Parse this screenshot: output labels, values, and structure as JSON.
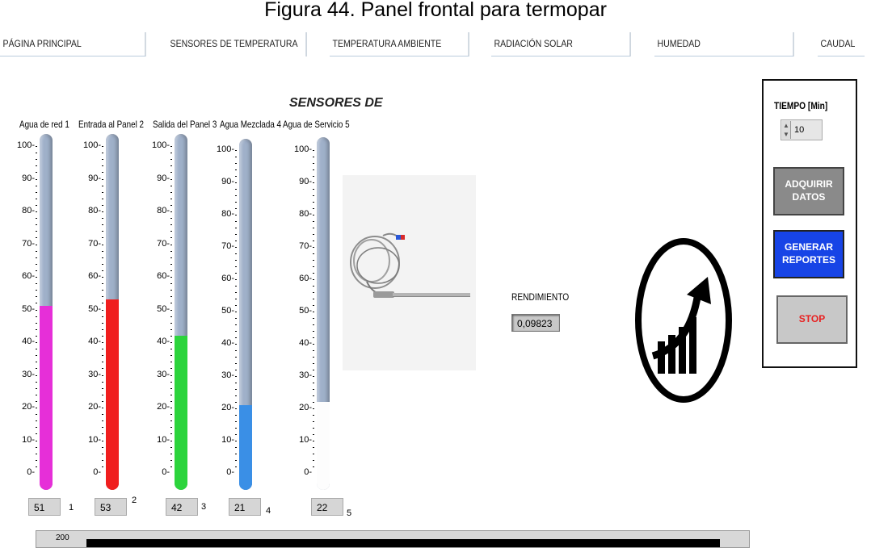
{
  "caption": "Figura 44. Panel frontal para termopar",
  "tabs": [
    "PÁGINA PRINCIPAL",
    "SENSORES DE TEMPERATURA",
    "TEMPERATURA AMBIENTE",
    "RADIACIÓN SOLAR",
    "HUMEDAD",
    "CAUDAL"
  ],
  "section_title": "SENSORES DE",
  "thermometers": [
    {
      "label": "Agua de red 1",
      "value": "51",
      "index": "1",
      "fill_pct": 51,
      "color": "#e62fd8"
    },
    {
      "label": "Entrada al Panel 2",
      "value": "53",
      "index": "2",
      "fill_pct": 53,
      "color": "#f01e1e"
    },
    {
      "label": "Salida del Panel 3",
      "value": "42",
      "index": "3",
      "fill_pct": 42,
      "color": "#2cd43c"
    },
    {
      "label": "Agua Mezclada 4",
      "value": "21",
      "index": "4",
      "fill_pct": 21,
      "color": "#3a8fe6"
    },
    {
      "label": "Agua de Servicio 5",
      "value": "22",
      "index": "5",
      "fill_pct": 22,
      "color": "#ffffff"
    }
  ],
  "scale_ticks": [
    "100",
    "90",
    "80",
    "70",
    "60",
    "50",
    "40",
    "30",
    "20",
    "10",
    "0"
  ],
  "rendimiento": {
    "label": "RENDIMIENTO",
    "value": "0,09823"
  },
  "controls": {
    "tiempo_label": "TIEMPO  [Min]",
    "tiempo_value": "10",
    "adquirir_label": "ADQUIRIR DATOS",
    "generar_label": "GENERAR REPORTES",
    "stop_label": "STOP"
  },
  "graph": {
    "ymax_label": "200"
  },
  "icons": {
    "growth": "growth-chart-icon",
    "sensor": "thermocouple-photo"
  }
}
